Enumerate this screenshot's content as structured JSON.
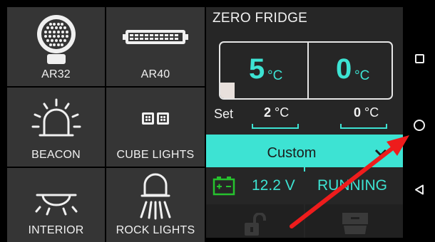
{
  "tiles": [
    {
      "label": "AR32",
      "icon": "round-spotlight-icon"
    },
    {
      "label": "AR40",
      "icon": "light-bar-icon"
    },
    {
      "label": "BEACON",
      "icon": "beacon-icon"
    },
    {
      "label": "CUBE LIGHTS",
      "icon": "cube-lights-icon"
    },
    {
      "label": "INTERIOR",
      "icon": "interior-light-icon"
    },
    {
      "label": "ROCK LIGHTS",
      "icon": "rock-lights-icon"
    }
  ],
  "fridge": {
    "title": "ZERO FRIDGE",
    "left_temp": "5",
    "right_temp": "0",
    "unit": "°C",
    "set_label": "Set",
    "set_left": "2",
    "set_right": "0",
    "set_unit": "°C",
    "mode": "Custom",
    "voltage": "12.2 V",
    "status": "RUNNING"
  },
  "colors": {
    "accent": "#3de3d3",
    "battery": "#26c22e",
    "tile_bg": "#353535",
    "panel_bg": "#262626",
    "arrow": "#ee1c1c"
  },
  "nav": {
    "icons": [
      "square-recents-icon",
      "circle-home-icon",
      "triangle-back-icon"
    ]
  }
}
